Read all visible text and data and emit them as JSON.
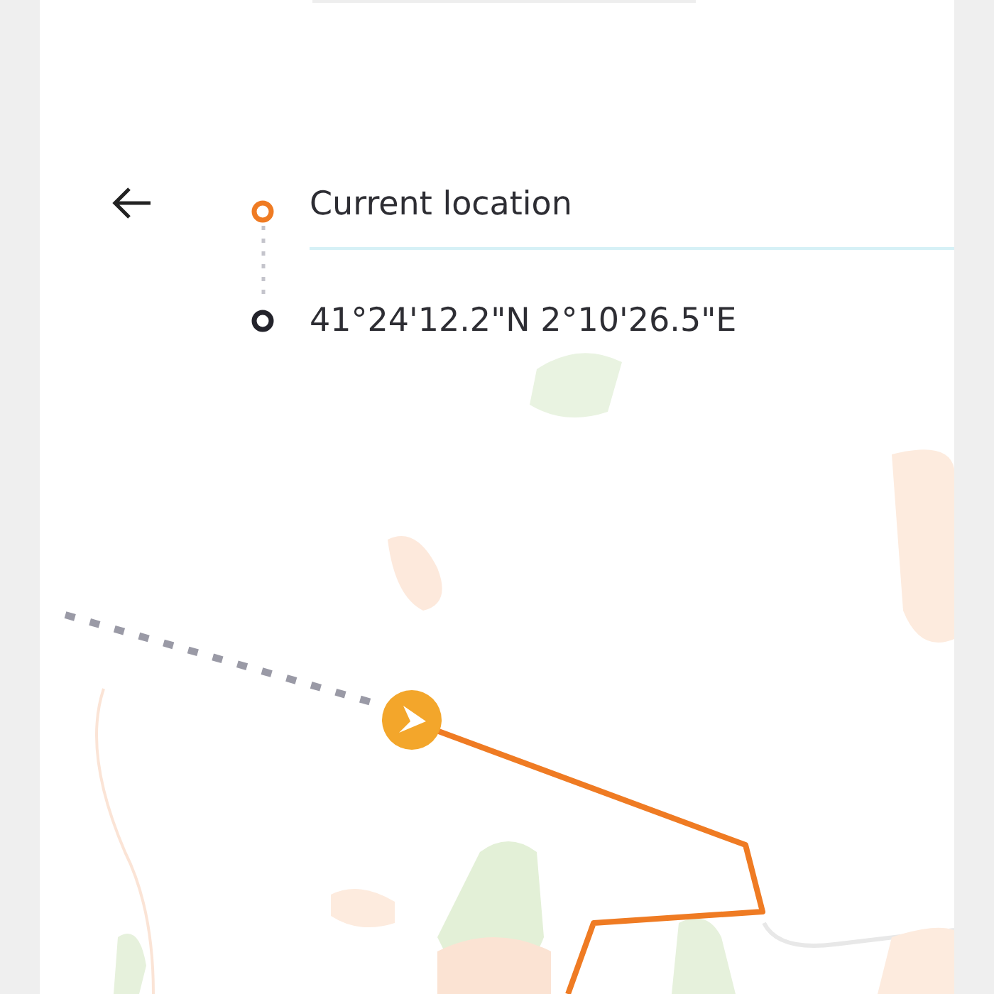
{
  "stops": [
    {
      "kind": "origin",
      "label": "Current location"
    },
    {
      "kind": "destination",
      "label": "41°24'12.2\"N 2°10'26.5\"E"
    }
  ]
}
